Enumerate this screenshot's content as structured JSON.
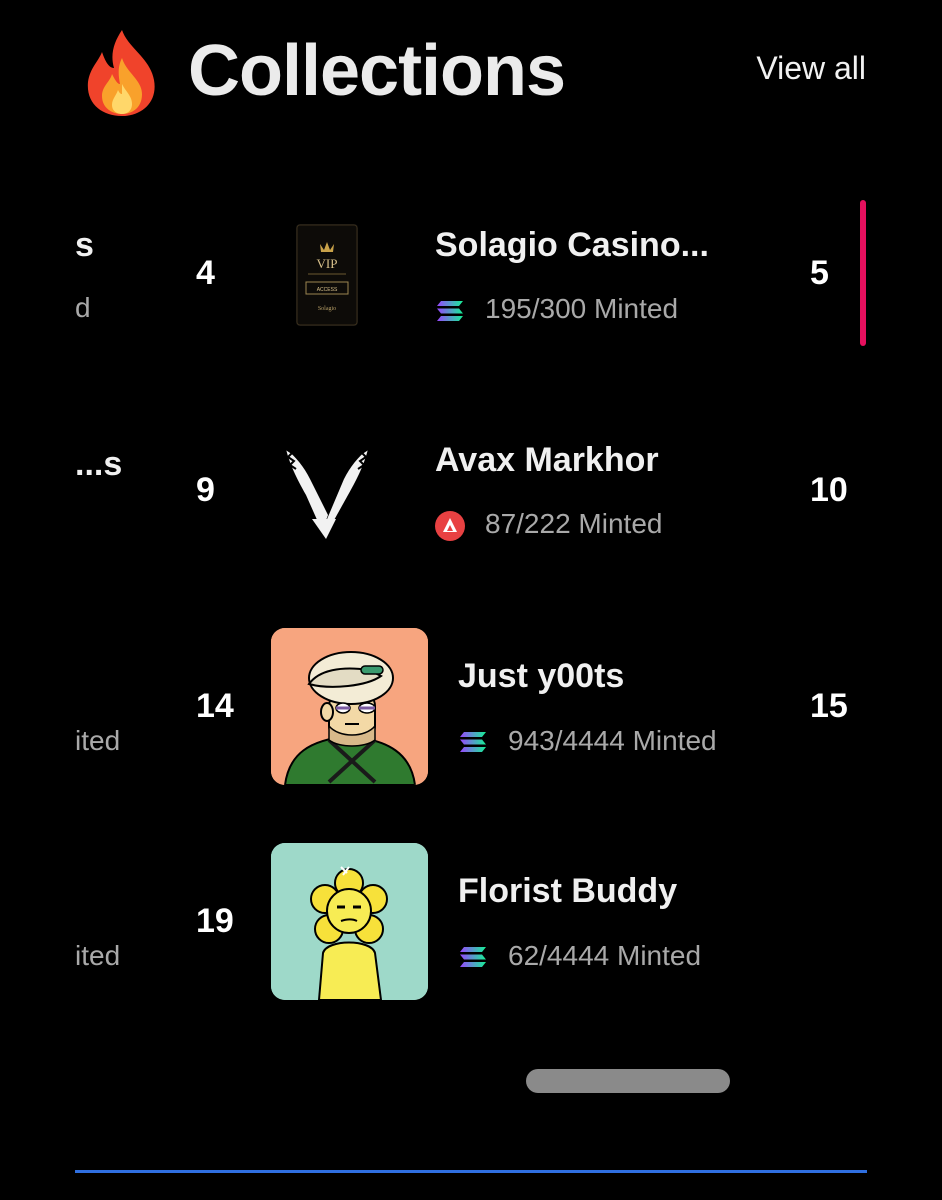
{
  "header": {
    "title": "Collections",
    "view_all": "View all",
    "icon": "fire-icon"
  },
  "left_fragments": {
    "row1_name": "s",
    "row1_minted": "d",
    "row2_name": "s...",
    "row3_minted": "ited",
    "row4_minted": "ited"
  },
  "collections": [
    {
      "rank": "4",
      "name": "Solagio Casino...",
      "minted": "195/300 Minted",
      "chain": "solana",
      "next_rank": "5",
      "thumb_text": {
        "vip": "VIP",
        "access": "ACCESS",
        "brand": "Solagio"
      }
    },
    {
      "rank": "9",
      "name": "Avax Markhor",
      "minted": "87/222 Minted",
      "chain": "avalanche",
      "next_rank": "10"
    },
    {
      "rank": "14",
      "name": "Just y00ts",
      "minted": "943/4444 Minted",
      "chain": "solana",
      "next_rank": "15"
    },
    {
      "rank": "19",
      "name": "Florist Buddy",
      "minted": "62/4444 Minted",
      "chain": "solana"
    }
  ],
  "colors": {
    "background": "#000000",
    "accent_pink": "#e6105e",
    "bottom_line": "#2f6fe0",
    "avax_red": "#e84142",
    "yoots_bg": "#f7a57f",
    "florist_bg": "#9ed9c9"
  }
}
